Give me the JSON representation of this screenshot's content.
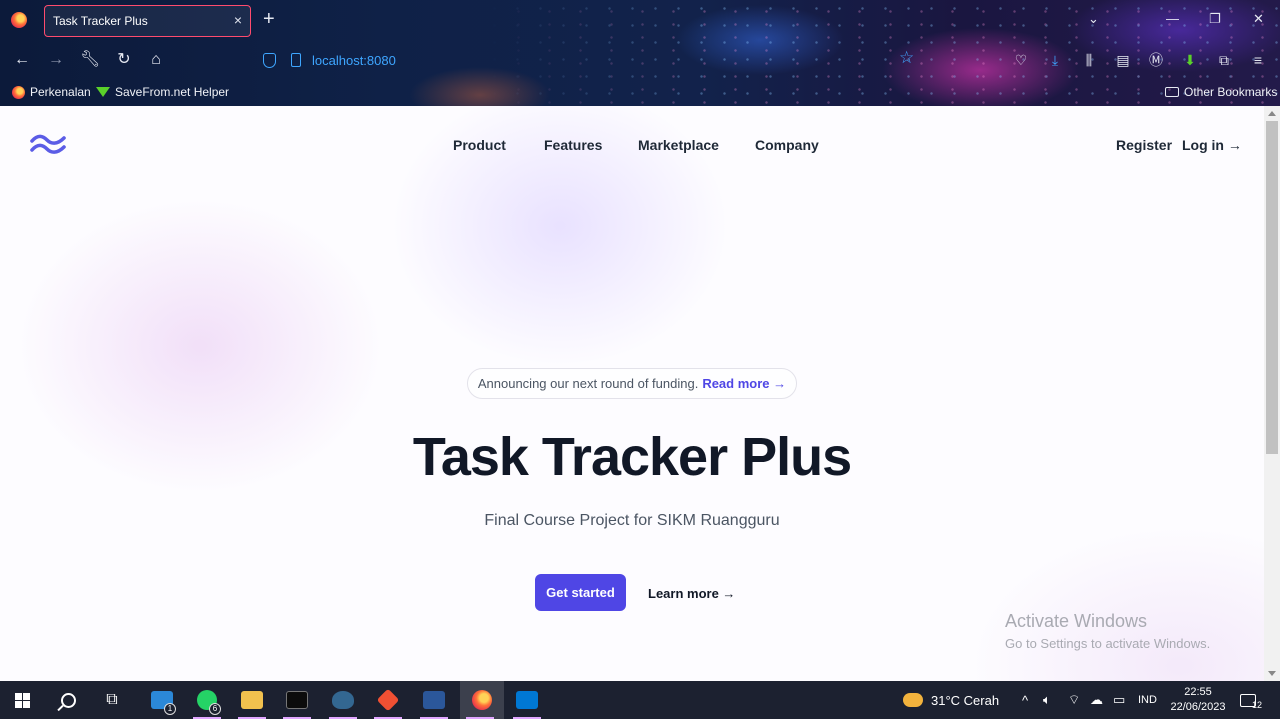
{
  "browser": {
    "tab_title": "Task Tracker Plus",
    "tab_close": "×",
    "new_tab": "+",
    "url": "localhost:8080",
    "bookmarks": [
      "Perkenalan",
      "SaveFrom.net Helper"
    ],
    "other_bookmarks": "Other Bookmarks",
    "controls": {
      "minimize": "—",
      "restore": "❐",
      "close": "✕",
      "tab_list": "⌄"
    },
    "nav_icons": [
      "back-icon",
      "forward-icon",
      "wrench-icon",
      "reload-icon",
      "home-icon"
    ],
    "toolbar_icons": [
      "pocket-icon",
      "download-icon",
      "library-icon",
      "sidebar-icon",
      "account-icon",
      "download-helper-icon",
      "extensions-icon",
      "menu-icon"
    ]
  },
  "site": {
    "nav": [
      "Product",
      "Features",
      "Marketplace",
      "Company"
    ],
    "register": "Register",
    "login": "Log in →",
    "announcement": "Announcing our next round of funding.",
    "announcement_link": "Read more →",
    "title": "Task Tracker Plus",
    "subtitle": "Final Course Project for SIKM Ruangguru",
    "cta_primary": "Get started",
    "cta_secondary": "Learn more →",
    "brand_color": "#4f46e5"
  },
  "watermark": {
    "title": "Activate Windows",
    "subtitle": "Go to Settings to activate Windows."
  },
  "taskbar": {
    "apps": [
      "start-icon",
      "search-icon",
      "task-view-icon",
      "mail-icon",
      "whatsapp-icon",
      "file-explorer-icon",
      "terminal-icon",
      "postgresql-icon",
      "git-icon",
      "word-icon",
      "firefox-icon",
      "vscode-icon"
    ],
    "mail_badge": "1",
    "whatsapp_badge": "6",
    "weather": "31°C  Cerah",
    "language": "IND",
    "time": "22:55",
    "date": "22/06/2023",
    "notifications": "12"
  }
}
